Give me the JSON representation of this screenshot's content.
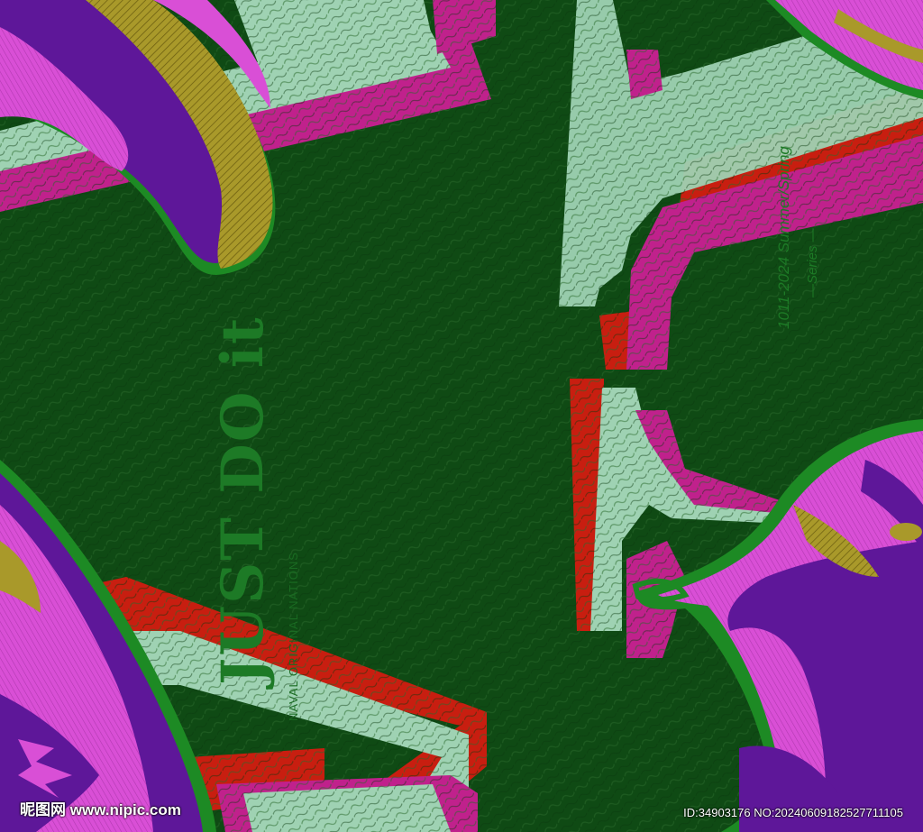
{
  "artwork": {
    "slogan": "JUST DO it",
    "slogan_sub": "NAVAL ORIGINAL NATIONS",
    "series_line1": "1011-2024 Summer/Spring",
    "series_line2": "—Series —"
  },
  "watermark": {
    "site": "昵图网 www.nipic.com",
    "id_text": "ID:34903176 NO:20240609182527711105"
  },
  "colors": {
    "background": "#0f4a14",
    "mint": "#9fd2b3",
    "magenta": "#c0218c",
    "red": "#c81e10",
    "purple": "#5e1799",
    "pink": "#d94fd6",
    "gold": "#a9992a",
    "outline": "#1d8a24"
  }
}
